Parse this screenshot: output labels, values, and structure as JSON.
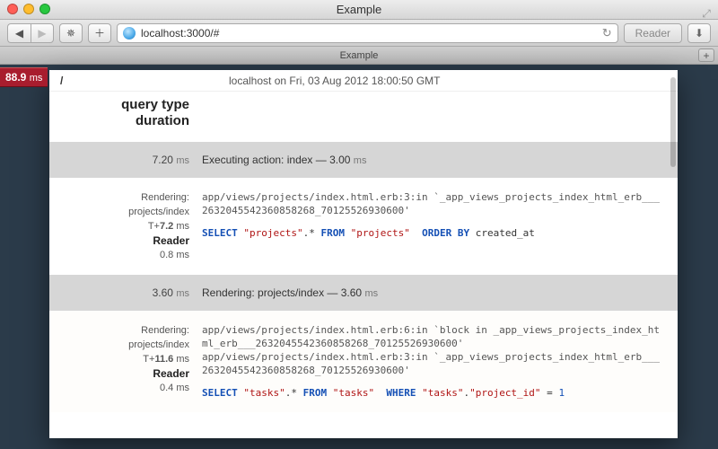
{
  "window": {
    "title": "Example"
  },
  "toolbar": {
    "url": "localhost:3000/#",
    "reader_label": "Reader"
  },
  "tab": {
    "title": "Example"
  },
  "badge": {
    "time": "88.9",
    "unit": "ms"
  },
  "panel": {
    "path": "/",
    "meta": "localhost on Fri, 03 Aug 2012 18:00:50 GMT",
    "label_query": "query type",
    "label_duration": "duration"
  },
  "sections": [
    {
      "bar_time": "7.20",
      "bar_unit": "ms",
      "bar_text": "Executing action: index — 3.00",
      "bar_text_unit": "ms",
      "side": {
        "rendering_label": "Rendering:",
        "rendering_val": "projects/index",
        "t_label": "T+",
        "t_val": "7.2",
        "t_unit": "ms",
        "reader_label": "Reader",
        "reader_val": "0.8",
        "reader_unit": "ms"
      },
      "trace": "app/views/projects/index.html.erb:3:in `_app_views_projects_index_html_erb___2632045542360858268_70125526930600'",
      "sql": {
        "kw1": "SELECT",
        "s1": "\"projects\"",
        "dot": ".*",
        "kw2": "FROM",
        "s2": "\"projects\"",
        "kw3": "ORDER BY",
        "tail": "created_at"
      }
    },
    {
      "bar_time": "3.60",
      "bar_unit": "ms",
      "bar_text": "Rendering: projects/index — 3.60",
      "bar_text_unit": "ms",
      "side": {
        "rendering_label": "Rendering:",
        "rendering_val": "projects/index",
        "t_label": "T+",
        "t_val": "11.6",
        "t_unit": "ms",
        "reader_label": "Reader",
        "reader_val": "0.4",
        "reader_unit": "ms"
      },
      "trace": "app/views/projects/index.html.erb:6:in `block in _app_views_projects_index_html_erb___2632045542360858268_70125526930600'\napp/views/projects/index.html.erb:3:in `_app_views_projects_index_html_erb___2632045542360858268_70125526930600'",
      "sql": {
        "kw1": "SELECT",
        "s1": "\"tasks\"",
        "dot": ".*",
        "kw2": "FROM",
        "s2": "\"tasks\"",
        "kw3": "WHERE",
        "s3": "\"tasks\"",
        "punc": ".",
        "s4": "\"project_id\"",
        "eq": " = ",
        "num": "1"
      }
    }
  ]
}
